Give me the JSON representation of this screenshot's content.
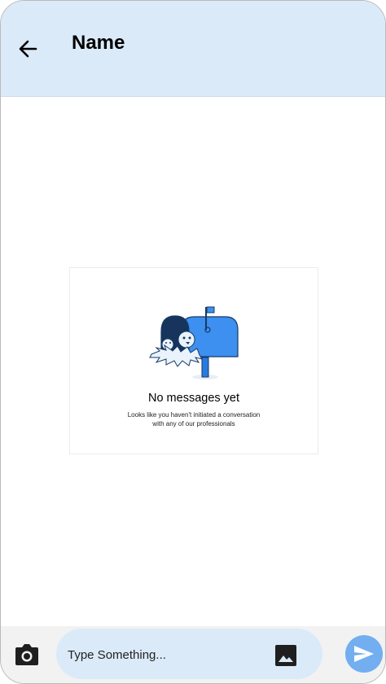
{
  "header": {
    "title": "Name",
    "back_icon": "arrow-left-icon",
    "background": "#dbeaf8"
  },
  "empty_state": {
    "title": "No messages yet",
    "subtitle_line1": "Looks like you haven't initiated a conversation",
    "subtitle_line2": "with any of our professionals",
    "illustration": "mailbox-with-birds-illustration"
  },
  "composer": {
    "placeholder": "Type Something...",
    "camera_icon": "camera-icon",
    "gallery_icon": "image-icon",
    "send_icon": "send-icon",
    "accent": "#72aef0",
    "input_background": "#dbeaf8"
  }
}
